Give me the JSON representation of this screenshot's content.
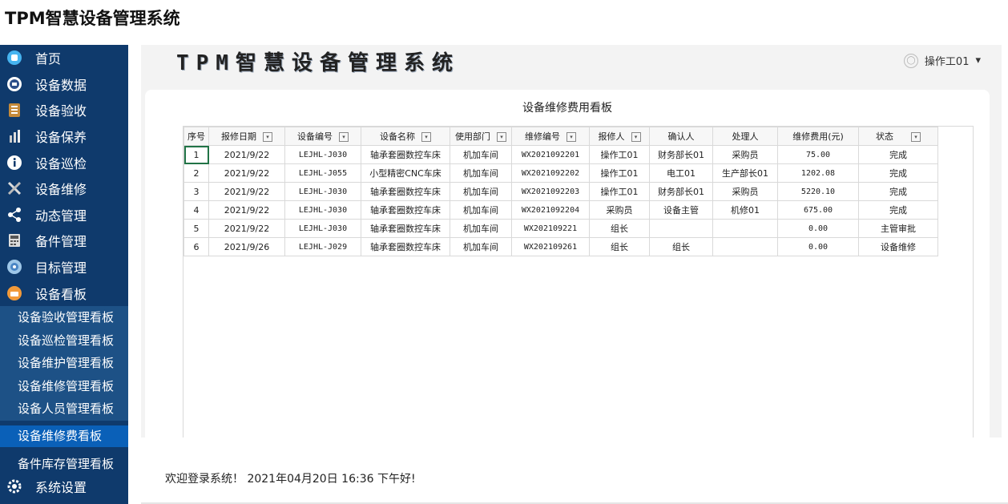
{
  "app": {
    "title": "TPM智慧设备管理系统"
  },
  "header": {
    "banner": "TPM智慧设备管理系统",
    "user": "操作工01",
    "dropdown": "▾"
  },
  "sidebar": {
    "items": [
      {
        "label": "首页"
      },
      {
        "label": "设备数据"
      },
      {
        "label": "设备验收"
      },
      {
        "label": "设备保养"
      },
      {
        "label": "设备巡检"
      },
      {
        "label": "设备维修"
      },
      {
        "label": "动态管理"
      },
      {
        "label": "备件管理"
      },
      {
        "label": "目标管理"
      },
      {
        "label": "设备看板"
      }
    ],
    "sub_items": [
      {
        "label": "设备验收管理看板"
      },
      {
        "label": "设备巡检管理看板"
      },
      {
        "label": "设备维护管理看板"
      },
      {
        "label": "设备维修管理看板"
      },
      {
        "label": "设备人员管理看板"
      },
      {
        "label": "设备维修费看板"
      },
      {
        "label": "备件库存管理看板"
      }
    ],
    "last_item": {
      "label": "系统设置"
    }
  },
  "board": {
    "title": "设备维修费用看板",
    "columns": [
      "序号",
      "报修日期",
      "设备编号",
      "设备名称",
      "使用部门",
      "维修编号",
      "报修人",
      "确认人",
      "处理人",
      "维修费用(元)",
      "状态"
    ],
    "rows": [
      [
        "1",
        "2021/9/22",
        "LEJHL-J030",
        "轴承套圈数控车床",
        "机加车间",
        "WX2021092201",
        "操作工01",
        "财务部长01",
        "采购员",
        "75.00",
        "完成"
      ],
      [
        "2",
        "2021/9/22",
        "LEJHL-J055",
        "小型精密CNC车床",
        "机加车间",
        "WX2021092202",
        "操作工01",
        "电工01",
        "生产部长01",
        "1202.08",
        "完成"
      ],
      [
        "3",
        "2021/9/22",
        "LEJHL-J030",
        "轴承套圈数控车床",
        "机加车间",
        "WX2021092203",
        "操作工01",
        "财务部长01",
        "采购员",
        "5220.10",
        "完成"
      ],
      [
        "4",
        "2021/9/22",
        "LEJHL-J030",
        "轴承套圈数控车床",
        "机加车间",
        "WX2021092204",
        "采购员",
        "设备主管",
        "机修01",
        "675.00",
        "完成"
      ],
      [
        "5",
        "2021/9/22",
        "LEJHL-J030",
        "轴承套圈数控车床",
        "机加车间",
        "WX202109221",
        "组长",
        "",
        "",
        "0.00",
        "主管审批"
      ],
      [
        "6",
        "2021/9/26",
        "LEJHL-J029",
        "轴承套圈数控车床",
        "机加车间",
        "WX202109261",
        "组长",
        "组长",
        "",
        "0.00",
        "设备维修"
      ]
    ]
  },
  "footer": {
    "text": "欢迎登录系统！ 2021年04月20日 16:36 下午好!"
  }
}
